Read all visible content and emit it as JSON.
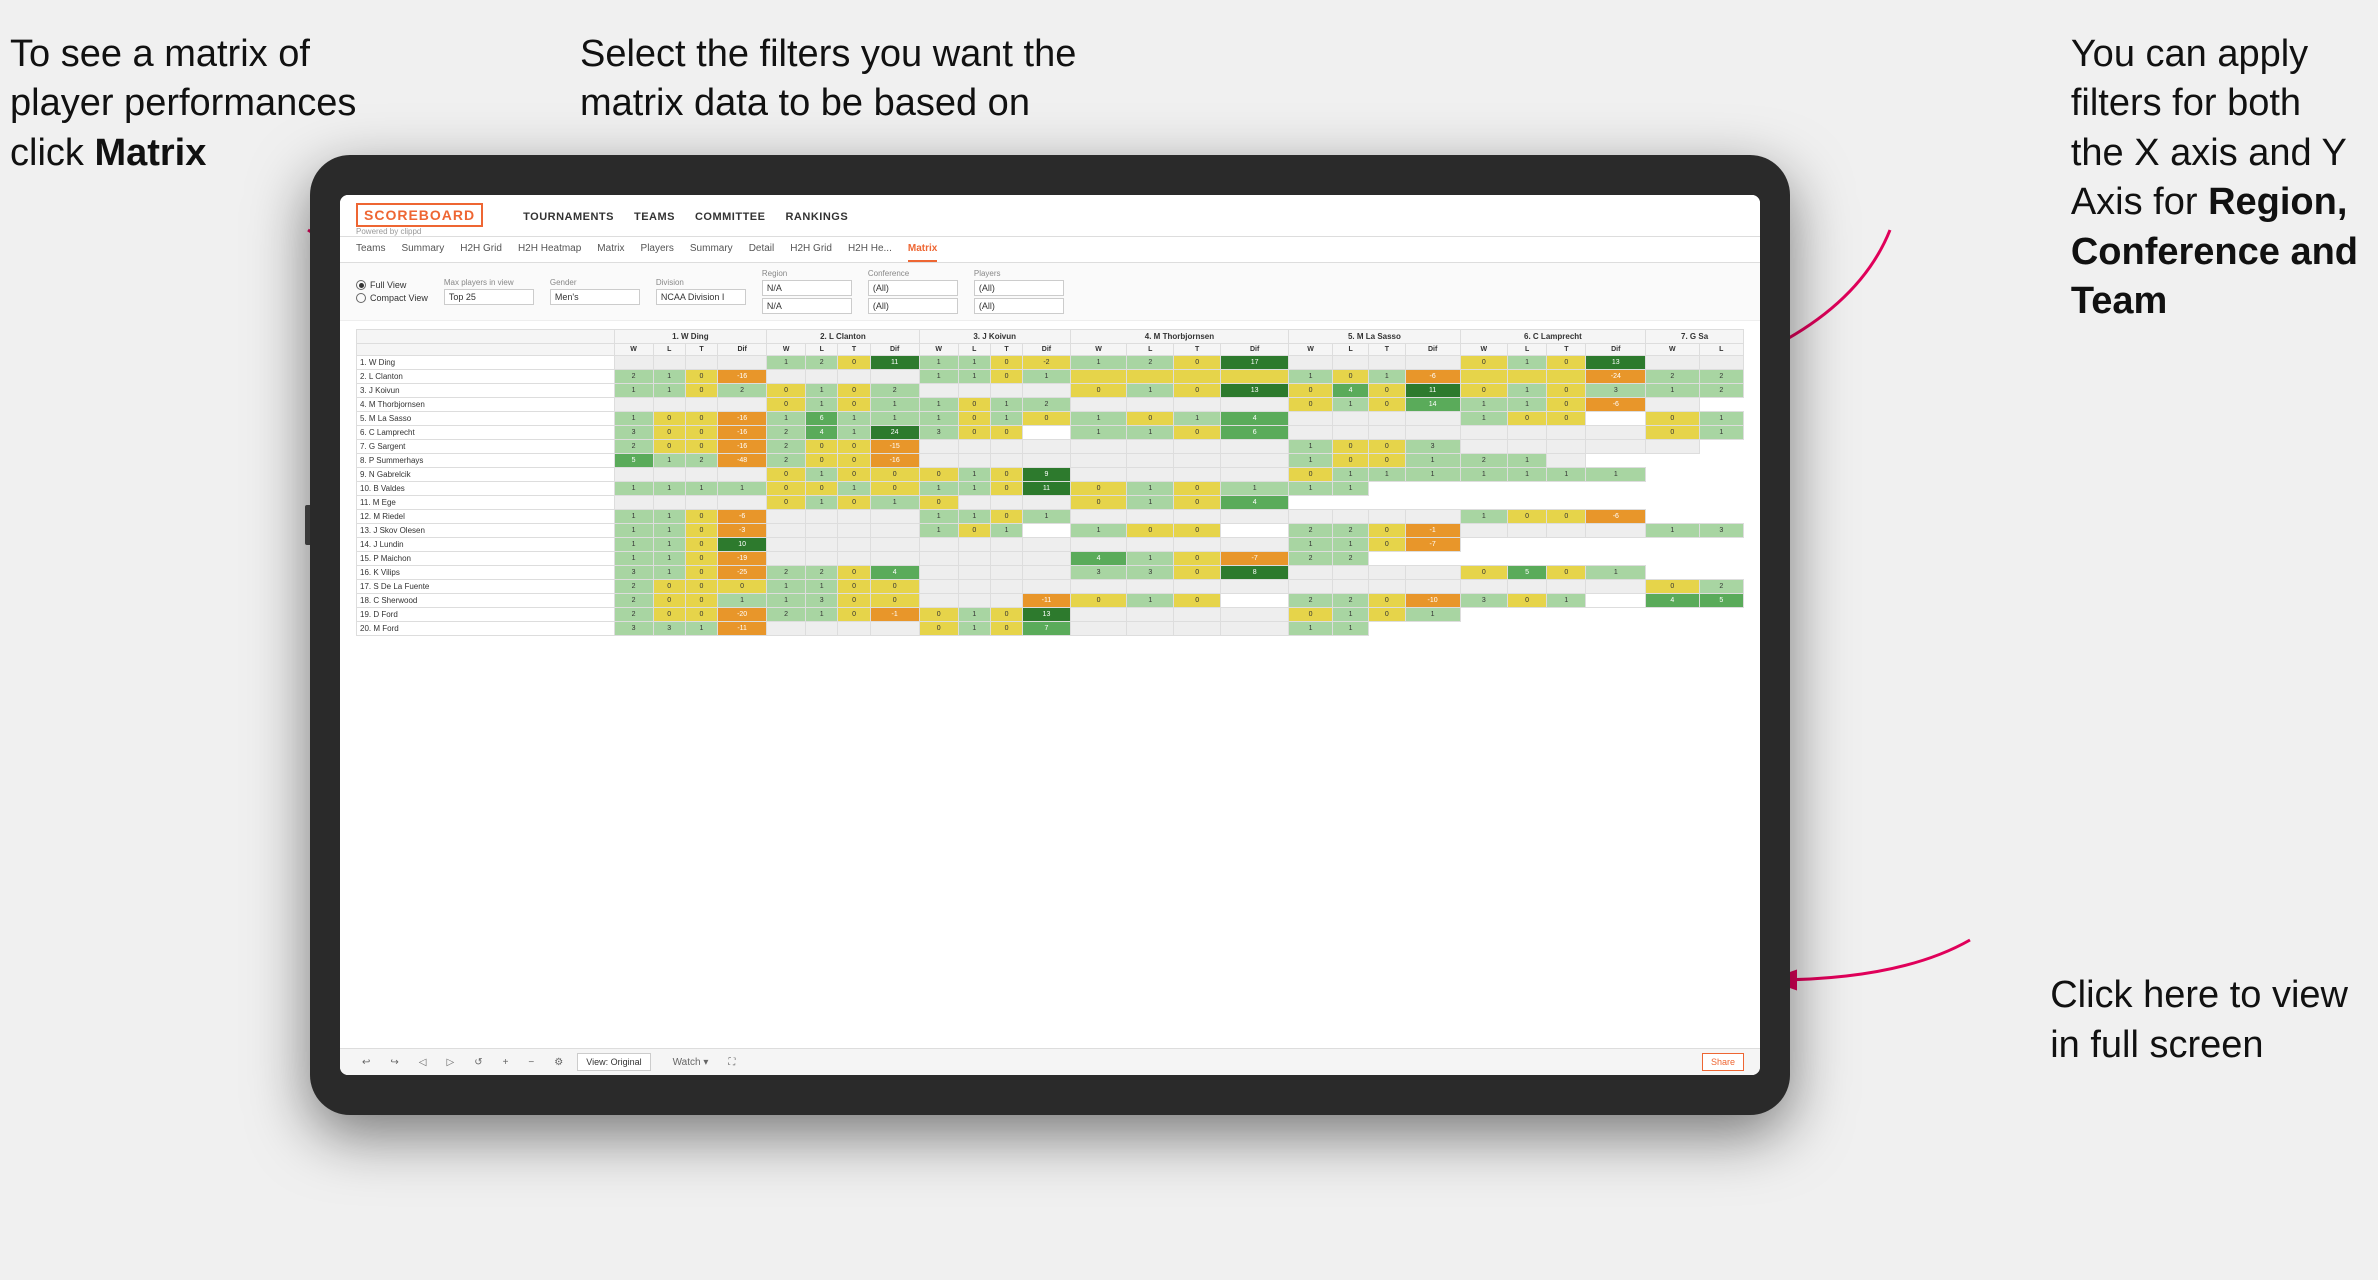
{
  "annotations": {
    "top_left": {
      "line1": "To see a matrix of",
      "line2": "player performances",
      "line3_prefix": "click ",
      "line3_bold": "Matrix"
    },
    "top_center": {
      "line1": "Select the filters you want the",
      "line2": "matrix data to be based on"
    },
    "top_right": {
      "line1": "You  can apply",
      "line2": "filters for both",
      "line3": "the X axis and Y",
      "line4_prefix": "Axis for ",
      "line4_bold": "Region,",
      "line5_bold": "Conference and",
      "line6_bold": "Team"
    },
    "bottom_right": {
      "line1": "Click here to view",
      "line2": "in full screen"
    }
  },
  "nav": {
    "logo": "SCOREBOARD",
    "logo_sub": "Powered by clippd",
    "items": [
      "TOURNAMENTS",
      "TEAMS",
      "COMMITTEE",
      "RANKINGS"
    ]
  },
  "sub_nav": {
    "items": [
      "Teams",
      "Summary",
      "H2H Grid",
      "H2H Heatmap",
      "Matrix",
      "Players",
      "Summary",
      "Detail",
      "H2H Grid",
      "H2H He...",
      "Matrix"
    ]
  },
  "filters": {
    "view_full": "Full View",
    "view_compact": "Compact View",
    "max_players_label": "Max players in view",
    "max_players_value": "Top 25",
    "gender_label": "Gender",
    "gender_value": "Men's",
    "division_label": "Division",
    "division_value": "NCAA Division I",
    "region_label": "Region",
    "region_value": "N/A",
    "region_value2": "N/A",
    "conference_label": "Conference",
    "conference_value": "(All)",
    "conference_value2": "(All)",
    "players_label": "Players",
    "players_value": "(All)",
    "players_value2": "(All)"
  },
  "matrix": {
    "col_headers": [
      "1. W Ding",
      "2. L Clanton",
      "3. J Koivun",
      "4. M Thorbjornsen",
      "5. M La Sasso",
      "6. C Lamprecht",
      "7. G Sa"
    ],
    "sub_headers": [
      "W",
      "L",
      "T",
      "Dif"
    ],
    "players": [
      {
        "name": "1. W Ding",
        "cells": [
          "",
          "",
          "",
          "",
          "1",
          "2",
          "0",
          "11",
          "1",
          "1",
          "0",
          "-2",
          "1",
          "2",
          "0",
          "17",
          "",
          "",
          "",
          "",
          "0",
          "1",
          "0",
          "13",
          "",
          ""
        ]
      },
      {
        "name": "2. L Clanton",
        "cells": [
          "2",
          "1",
          "0",
          "-16",
          "",
          "",
          "",
          "",
          "1",
          "1",
          "0",
          "1",
          "",
          "",
          "",
          "",
          "1",
          "0",
          "1",
          "-6",
          "",
          "",
          "",
          "-24",
          "2",
          "2"
        ]
      },
      {
        "name": "3. J Koivun",
        "cells": [
          "1",
          "1",
          "0",
          "2",
          "0",
          "1",
          "0",
          "2",
          "",
          "",
          "",
          "",
          "0",
          "1",
          "0",
          "13",
          "0",
          "4",
          "0",
          "11",
          "0",
          "1",
          "0",
          "3",
          "1",
          "2"
        ]
      },
      {
        "name": "4. M Thorbjornsen",
        "cells": [
          "",
          "",
          "",
          "",
          "0",
          "1",
          "0",
          "1",
          "1",
          "0",
          "1",
          "2",
          "",
          "",
          "",
          "",
          "0",
          "1",
          "0",
          "14",
          "1",
          "1",
          "0",
          "-6",
          ""
        ]
      },
      {
        "name": "5. M La Sasso",
        "cells": [
          "1",
          "0",
          "0",
          "-16",
          "1",
          "6",
          "1",
          "1",
          "1",
          "0",
          "1",
          "0",
          "1",
          "0",
          "1",
          "4",
          "",
          "",
          "",
          "",
          "1",
          "0",
          "0",
          "",
          "0",
          "1"
        ]
      },
      {
        "name": "6. C Lamprecht",
        "cells": [
          "3",
          "0",
          "0",
          "-16",
          "2",
          "4",
          "1",
          "24",
          "3",
          "0",
          "0",
          "",
          "1",
          "1",
          "0",
          "6",
          "",
          "",
          "",
          "",
          "",
          "",
          "",
          "",
          "0",
          "1"
        ]
      },
      {
        "name": "7. G Sargent",
        "cells": [
          "2",
          "0",
          "0",
          "-16",
          "2",
          "0",
          "0",
          "-15",
          "",
          "",
          "",
          "",
          "",
          "",
          "",
          "",
          "1",
          "0",
          "0",
          "3",
          "",
          "",
          "",
          "",
          ""
        ]
      },
      {
        "name": "8. P Summerhays",
        "cells": [
          "5",
          "1",
          "2",
          "-48",
          "2",
          "0",
          "0",
          "-16",
          "",
          "",
          "",
          "",
          "",
          "",
          "",
          "",
          "1",
          "0",
          "0",
          "1",
          "2",
          "1",
          ""
        ]
      },
      {
        "name": "9. N Gabrelcik",
        "cells": [
          "",
          "",
          "",
          "",
          "0",
          "1",
          "0",
          "0",
          "0",
          "1",
          "0",
          "9",
          "",
          "",
          "",
          "",
          "0",
          "1",
          "1",
          "1",
          "1",
          "1",
          "1",
          "1"
        ]
      },
      {
        "name": "10. B Valdes",
        "cells": [
          "1",
          "1",
          "1",
          "1",
          "0",
          "0",
          "1",
          "0",
          "1",
          "1",
          "0",
          "11",
          "0",
          "1",
          "0",
          "1",
          "1",
          "1"
        ]
      },
      {
        "name": "11. M Ege",
        "cells": [
          "",
          "",
          "",
          "",
          "0",
          "1",
          "0",
          "1",
          "0",
          "",
          "",
          "",
          "0",
          "1",
          "0",
          "4"
        ]
      },
      {
        "name": "12. M Riedel",
        "cells": [
          "1",
          "1",
          "0",
          "-6",
          "",
          "",
          "",
          "",
          "1",
          "1",
          "0",
          "1",
          "",
          "",
          "",
          "",
          "",
          "",
          "",
          "",
          "1",
          "0",
          "0",
          "-6"
        ]
      },
      {
        "name": "13. J Skov Olesen",
        "cells": [
          "1",
          "1",
          "0",
          "-3",
          "",
          "",
          "",
          "",
          "1",
          "0",
          "1",
          "",
          "1",
          "0",
          "0",
          "",
          "2",
          "2",
          "0",
          "-1",
          "",
          "",
          "",
          "",
          "1",
          "3"
        ]
      },
      {
        "name": "14. J Lundin",
        "cells": [
          "1",
          "1",
          "0",
          "10",
          "",
          "",
          "",
          "",
          "",
          "",
          "",
          "",
          "",
          "",
          "",
          "",
          "1",
          "1",
          "0",
          "-7"
        ]
      },
      {
        "name": "15. P Maichon",
        "cells": [
          "1",
          "1",
          "0",
          "-19",
          "",
          "",
          "",
          "",
          "",
          "",
          "",
          "",
          "4",
          "1",
          "0",
          "-7",
          "2",
          "2"
        ]
      },
      {
        "name": "16. K Vilips",
        "cells": [
          "3",
          "1",
          "0",
          "-25",
          "2",
          "2",
          "0",
          "4",
          "",
          "",
          "",
          "",
          "3",
          "3",
          "0",
          "8",
          "",
          "",
          "",
          "",
          "0",
          "5",
          "0",
          "1"
        ]
      },
      {
        "name": "17. S De La Fuente",
        "cells": [
          "2",
          "0",
          "0",
          "0",
          "1",
          "1",
          "0",
          "0",
          "",
          "",
          "",
          "",
          "",
          "",
          "",
          "",
          "",
          "",
          "",
          "",
          "",
          "",
          "",
          "",
          "0",
          "2"
        ]
      },
      {
        "name": "18. C Sherwood",
        "cells": [
          "2",
          "0",
          "0",
          "1",
          "1",
          "3",
          "0",
          "0",
          "",
          "",
          "",
          "-11",
          "0",
          "1",
          "0",
          "",
          "2",
          "2",
          "0",
          "-10",
          "3",
          "0",
          "1",
          "",
          "4",
          "5"
        ]
      },
      {
        "name": "19. D Ford",
        "cells": [
          "2",
          "0",
          "0",
          "-20",
          "2",
          "1",
          "0",
          "-1",
          "0",
          "1",
          "0",
          "13",
          "",
          "",
          "",
          "",
          "0",
          "1",
          "0",
          "1"
        ]
      },
      {
        "name": "20. M Ford",
        "cells": [
          "3",
          "3",
          "1",
          "-11",
          "",
          "",
          "",
          "",
          "0",
          "1",
          "0",
          "7",
          "",
          "",
          "",
          "",
          "1",
          "1"
        ]
      }
    ]
  },
  "toolbar": {
    "view_label": "View: Original",
    "watch_label": "Watch ▾",
    "share_label": "Share"
  }
}
